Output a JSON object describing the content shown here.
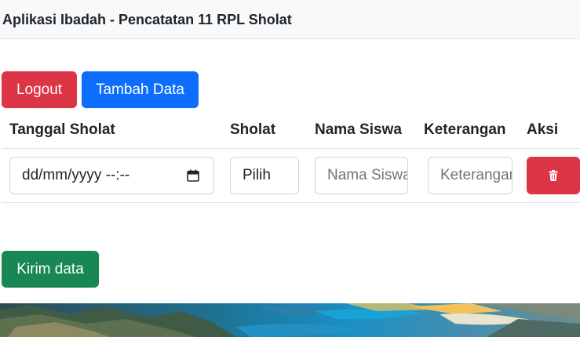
{
  "navbar": {
    "brand": "Aplikasi Ibadah - Pencatatan 11 RPL Sholat"
  },
  "actions": {
    "logout_label": "Logout",
    "add_label": "Tambah Data",
    "submit_label": "Kirim data"
  },
  "table": {
    "headers": [
      "Tanggal Sholat",
      "Sholat",
      "Nama Siswa",
      "Keterangan",
      "Aksi"
    ],
    "row": {
      "date_placeholder": "dd/mm/yyyy --:--",
      "prayer_value": "Pilih",
      "name_placeholder": "Nama Siswa",
      "note_placeholder": "Keterangan",
      "delete_icon": "trash-icon"
    }
  },
  "colors": {
    "danger": "#dc3545",
    "primary": "#0d6efd",
    "success": "#198754"
  }
}
